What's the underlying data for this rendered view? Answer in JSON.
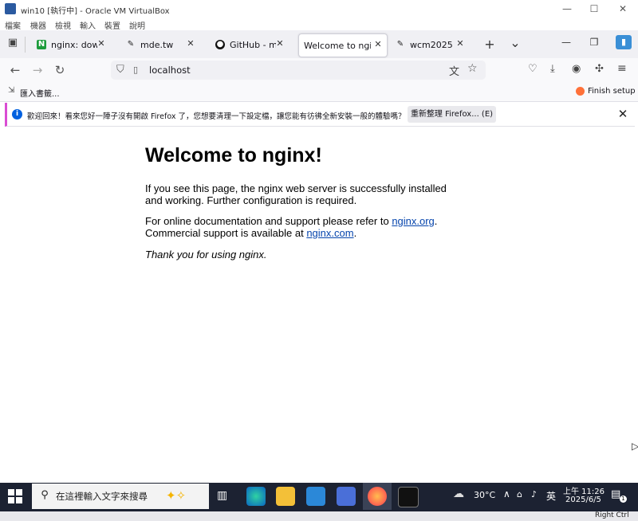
{
  "vbox": {
    "title": "win10 [執行中] - Oracle VM VirtualBox",
    "menu": [
      "檔案",
      "機器",
      "檢視",
      "輸入",
      "裝置",
      "說明"
    ],
    "minimize": "—",
    "maximize": "☐",
    "close": "✕"
  },
  "tabs": [
    {
      "label": "nginx: downloa",
      "icon": "nginx-icon",
      "active": false
    },
    {
      "label": "mde.tw",
      "icon": "mde-icon",
      "active": false
    },
    {
      "label": "GitHub - mdecy",
      "icon": "github-icon",
      "active": false
    },
    {
      "label": "Welcome to nginx!",
      "icon": "",
      "active": true
    },
    {
      "label": "wcm2025",
      "icon": "mde-icon",
      "active": false
    }
  ],
  "tab_close": "✕",
  "tab_new": "+",
  "tab_list": "⌄",
  "window": {
    "minimize": "—",
    "restore": "❐",
    "close": "✕"
  },
  "nav": {
    "back": "←",
    "forward": "→",
    "reload": "↻",
    "url": "localhost"
  },
  "bookmarks": {
    "import_label": "匯入書籤...",
    "finish_setup": "Finish setup"
  },
  "notification": {
    "message": "歡迎回來！看來您好一陣子沒有開啟 Firefox 了，您想要清理一下設定檔，讓您能有彷彿全新安裝一般的體驗嗎？",
    "button": "重新整理 Firefox... (E)",
    "close": "✕"
  },
  "page": {
    "heading": "Welcome to nginx!",
    "p1": "If you see this page, the nginx web server is successfully installed and working. Further configuration is required.",
    "p2_prefix": "For online documentation and support please refer to ",
    "p2_link1": "nginx.org",
    "p2_mid": ". Commercial support is available at ",
    "p2_link2": "nginx.com",
    "p2_suffix": ".",
    "p3": "Thank you for using nginx."
  },
  "taskbar": {
    "search_placeholder": "在這裡輸入文字來搜尋",
    "weather": "30°C",
    "ime": "英",
    "time": "上午 11:26",
    "date": "2025/6/5",
    "notification_count": "1",
    "host_key": "Right Ctrl"
  },
  "colors": {
    "accent_blue": "#0060df",
    "notif_stripe": "#d94cd3",
    "taskbar": "#1c2232"
  }
}
